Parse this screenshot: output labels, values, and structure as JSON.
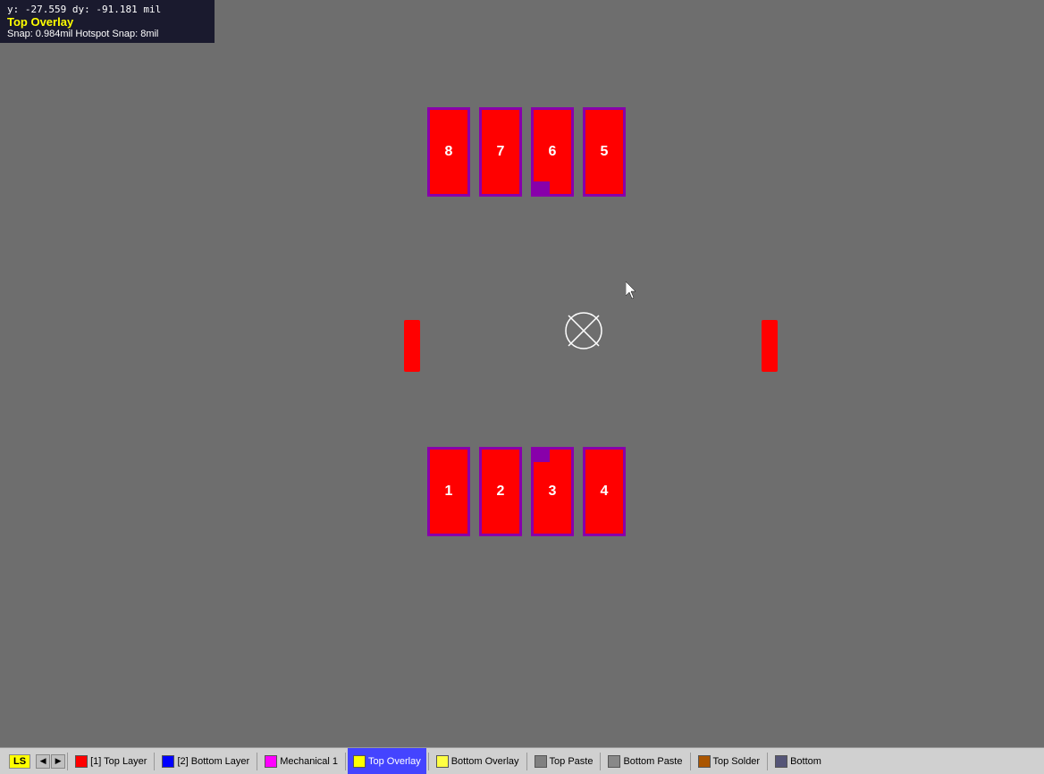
{
  "info_panel": {
    "coords": "y: -27.559  dy: -91.181 mil",
    "layer_name": "Top Overlay",
    "snap_info": "Snap: 0.984mil Hotspot Snap: 8mil"
  },
  "pads": {
    "top_row": [
      {
        "id": "pad-8",
        "label": "8"
      },
      {
        "id": "pad-7",
        "label": "7"
      },
      {
        "id": "pad-6",
        "label": "6"
      },
      {
        "id": "pad-5",
        "label": "5"
      }
    ],
    "bottom_row": [
      {
        "id": "pad-1",
        "label": "1"
      },
      {
        "id": "pad-2",
        "label": "2"
      },
      {
        "id": "pad-3",
        "label": "3"
      },
      {
        "id": "pad-4",
        "label": "4"
      }
    ]
  },
  "toolbar": {
    "ls_label": "LS",
    "layers": [
      {
        "label": "[1] Top Layer",
        "color": "#ff0000"
      },
      {
        "label": "[2] Bottom Layer",
        "color": "#0000ff"
      },
      {
        "label": "Mechanical 1",
        "color": "#ff00ff"
      },
      {
        "label": "Top Overlay",
        "color": "#ffff00",
        "active": true
      },
      {
        "label": "Bottom Overlay",
        "color": "#ffff00"
      },
      {
        "label": "Top Paste",
        "color": "#808080"
      },
      {
        "label": "Bottom Paste",
        "color": "#808080"
      },
      {
        "label": "Top Solder",
        "color": "#888888"
      },
      {
        "label": "Bottom",
        "color": "#888888"
      }
    ]
  }
}
